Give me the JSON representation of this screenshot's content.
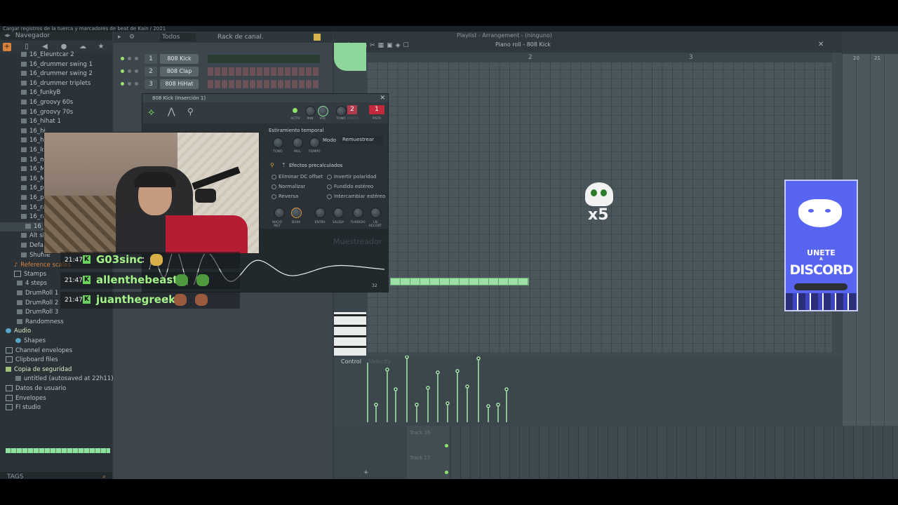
{
  "window": {
    "title": "Cargar registros de la tuerca y marcadores de beat de Kain / 2021"
  },
  "browser": {
    "header": "Navegador",
    "items": [
      {
        "label": "16_Eleuntcar 2"
      },
      {
        "label": "16_drummer swing 1"
      },
      {
        "label": "16_drummer swing 2"
      },
      {
        "label": "16_drummer triplets"
      },
      {
        "label": "16_funkyB"
      },
      {
        "label": "16_groovy 60s"
      },
      {
        "label": "16_groovy 70s"
      },
      {
        "label": "16_hihat 1"
      },
      {
        "label": "16_hi"
      },
      {
        "label": "16_hi"
      },
      {
        "label": "16_lo"
      },
      {
        "label": "16_m"
      },
      {
        "label": "16_M"
      },
      {
        "label": "16_M"
      },
      {
        "label": "16_pu"
      },
      {
        "label": "16_pu"
      },
      {
        "label": "16_ra"
      },
      {
        "label": "16_ra"
      },
      {
        "label": "16_"
      },
      {
        "label": "Alt sh"
      },
      {
        "label": "Defau"
      },
      {
        "label": "Shuffle"
      },
      {
        "label": "Reference scales"
      },
      {
        "label": "Stamps"
      },
      {
        "label": "4 steps"
      },
      {
        "label": "DrumRoll 1"
      },
      {
        "label": "DrumRoll 2"
      },
      {
        "label": "DrumRoll 3"
      },
      {
        "label": "Randomness"
      },
      {
        "label": "Audio"
      },
      {
        "label": "Shapes"
      },
      {
        "label": "Channel envelopes"
      },
      {
        "label": "Clipboard files"
      },
      {
        "label": "Copia de seguridad"
      },
      {
        "label": "untitled (autosaved at 22h11)"
      },
      {
        "label": "Datos de usuario"
      },
      {
        "label": "Envelopes"
      },
      {
        "label": "Fl studio"
      }
    ],
    "tags_label": "TAGS"
  },
  "rack": {
    "filter": "Todos",
    "title": "Rack de canal.",
    "channels": [
      {
        "num": "1",
        "name": "808 Kick"
      },
      {
        "num": "2",
        "name": "808 Clap"
      },
      {
        "num": "3",
        "name": "808 HiHat"
      }
    ]
  },
  "sampler": {
    "title": "808 Kick (Inserción 1)",
    "knob_labels": [
      "ACTIV",
      "PAN",
      "VOL",
      "TONO",
      "RANGO",
      "PISTA"
    ],
    "pitch_value": "2",
    "track_value": "1",
    "stretch_title": "Estiramiento temporal",
    "stretch_knobs": [
      "TONO",
      "MUL",
      "TIEMPO"
    ],
    "mode_label": "Modo",
    "mode_value": "Remuestrear",
    "precomp_title": "Efectos precalculados",
    "options": [
      "Eliminar DC offset",
      "Invertir polaridad",
      "Normalizar",
      "Fundido estéreo",
      "Reversa",
      "Intercambiar estéreo"
    ],
    "bottom_knobs": [
      "INICIO MST",
      "DURA",
      "ENTRA",
      "SALIDA",
      "FUNDIDO",
      "LN RECORT"
    ],
    "watermark": "Muestreador",
    "sample_count": "32"
  },
  "playlist": {
    "title": "Playlist - Arrangement - (ninguno)"
  },
  "pianoroll": {
    "title": "Piano roll - 808 Kick",
    "ruler": [
      "2",
      "3"
    ],
    "control_label": "Control",
    "control_sub": "Velocity",
    "tracks": [
      "Track 16",
      "Track 17"
    ],
    "bar_numbers": [
      "20",
      "21"
    ]
  },
  "chat": [
    {
      "time": "21:47",
      "user": "G03sinc",
      "sep": ":"
    },
    {
      "time": "21:47",
      "user": "allenthebeast",
      "sep": ":"
    },
    {
      "time": "21:47",
      "user": "juanthegreek",
      "sep": ":"
    }
  ],
  "overlays": {
    "multiplier": "x5",
    "discord_line1": "UNETE",
    "discord_line2": "A",
    "discord_line3": "DISCORD"
  },
  "colors": {
    "accent_green": "#8ee2a0",
    "discord": "#5865f2",
    "chat_user": "#a3f287"
  }
}
